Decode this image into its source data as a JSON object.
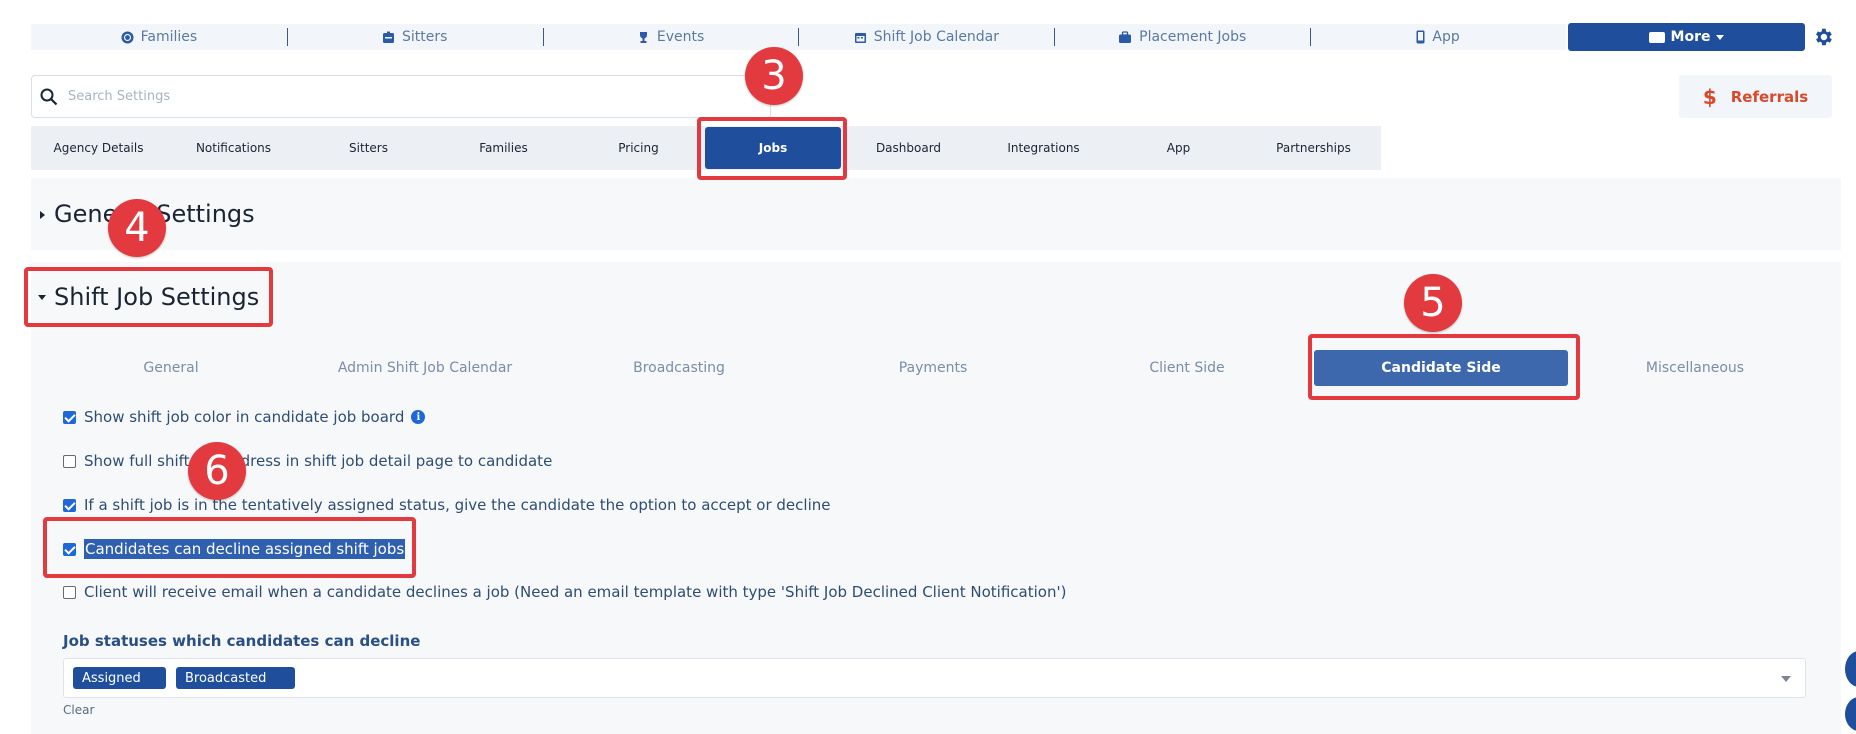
{
  "topnav": {
    "items": [
      {
        "label": "Families",
        "icon": "globe-icon"
      },
      {
        "label": "Sitters",
        "icon": "id-badge-icon"
      },
      {
        "label": "Events",
        "icon": "trophy-icon"
      },
      {
        "label": "Shift Job Calendar",
        "icon": "calendar-icon"
      },
      {
        "label": "Placement Jobs",
        "icon": "briefcase-icon"
      },
      {
        "label": "App",
        "icon": "mobile-icon"
      }
    ],
    "more_label": "More"
  },
  "search": {
    "placeholder": "Search Settings"
  },
  "referrals": {
    "label": "Referrals",
    "symbol": "$"
  },
  "tabs": [
    "Agency Details",
    "Notifications",
    "Sitters",
    "Families",
    "Pricing",
    "Jobs",
    "Dashboard",
    "Integrations",
    "App",
    "Partnerships"
  ],
  "active_tab": "Jobs",
  "sections": {
    "general": {
      "title": "General Settings"
    },
    "shift": {
      "title": "Shift Job Settings"
    }
  },
  "subtabs": [
    "General",
    "Admin Shift Job Calendar",
    "Broadcasting",
    "Payments",
    "Client Side",
    "Candidate Side",
    "Miscellaneous"
  ],
  "active_subtab": "Candidate Side",
  "options": [
    {
      "label": "Show shift job color in candidate job board",
      "checked": true,
      "info": true
    },
    {
      "label": "Show full shift job address in shift job detail page to candidate",
      "checked": false
    },
    {
      "label": "If a shift job is in the tentatively assigned status, give the candidate the option to accept or decline",
      "checked": true
    },
    {
      "label": "Candidates can decline assigned shift jobs",
      "checked": true
    },
    {
      "label": "Client will receive email when a candidate declines a job (Need an email template with type 'Shift Job Declined Client Notification')",
      "checked": false
    }
  ],
  "statuses": {
    "label": "Job statuses which candidates can decline",
    "chips": [
      "Assigned",
      "Broadcasted"
    ],
    "clear_label": "Clear"
  },
  "annotations": {
    "badge3": "3",
    "badge4": "4",
    "badge5": "5",
    "badge6": "6"
  },
  "colors": {
    "primary": "#1f4f9c",
    "accent_red": "#e23a3f",
    "referral": "#d84a2b"
  }
}
